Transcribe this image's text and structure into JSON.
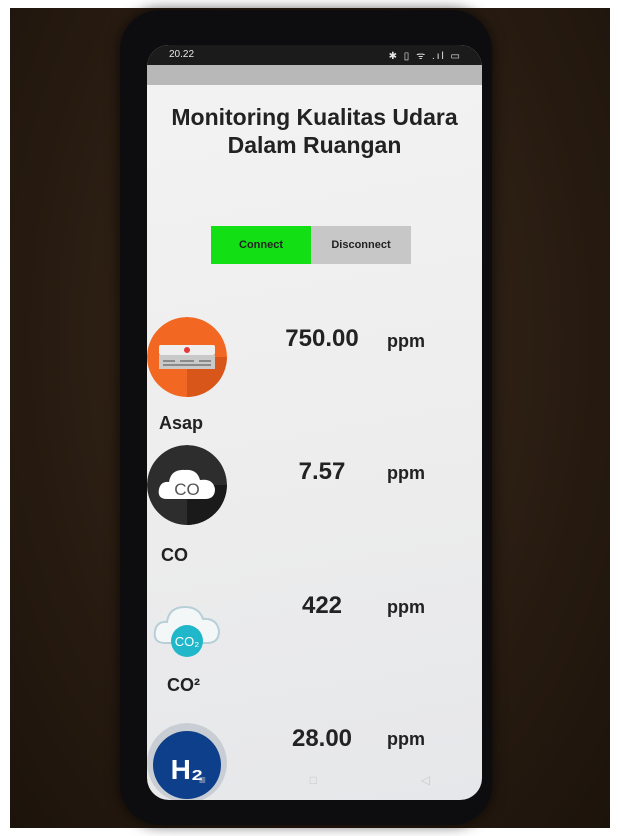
{
  "status_bar": {
    "time": "20.22",
    "icons": [
      "bluetooth-icon",
      "vibrate-icon",
      "wifi-icon",
      "signal-icon",
      "battery-icon"
    ],
    "icons_text": "✱ ▯ ᯤ .ıl ▭"
  },
  "header": {
    "title_line1": "Monitoring Kualitas Udara",
    "title_line2": "Dalam Ruangan"
  },
  "buttons": {
    "connect_label": "Connect",
    "disconnect_label": "Disconnect",
    "connect_color": "#12e014",
    "disconnect_color": "#c7c7c7"
  },
  "sensors": [
    {
      "name": "Asap",
      "value": "750.00",
      "unit": "ppm",
      "icon": "smoke-detector-icon"
    },
    {
      "name": "CO",
      "value": "7.57",
      "unit": "ppm",
      "icon": "co-cloud-icon"
    },
    {
      "name": "CO²",
      "value": "422",
      "unit": "ppm",
      "icon": "co2-cloud-icon"
    },
    {
      "name": "",
      "value": "28.00",
      "unit": "ppm",
      "icon": "h2-icon"
    }
  ],
  "nav": {
    "menu_icon": "≡",
    "home_icon": "□",
    "back_icon": "◁"
  }
}
